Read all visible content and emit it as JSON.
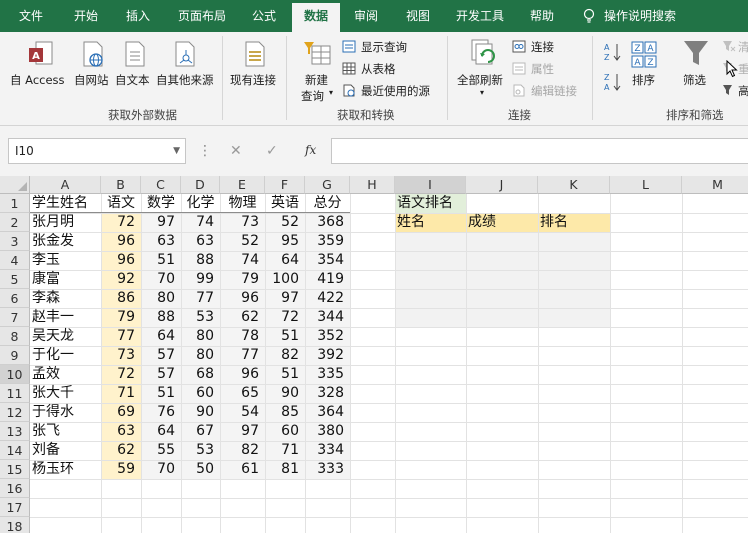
{
  "tabs": [
    "文件",
    "开始",
    "插入",
    "页面布局",
    "公式",
    "数据",
    "审阅",
    "视图",
    "开发工具",
    "帮助",
    "操作说明搜索"
  ],
  "active_tab": "数据",
  "ribbon": {
    "get_external": {
      "access": "自 Access",
      "web": "自网站",
      "text": "自文本",
      "other": "自其他来源",
      "existing": "现有连接",
      "label": "获取外部数据"
    },
    "get_transform": {
      "new_query_1": "新建",
      "new_query_2": "查询",
      "show_queries": "显示查询",
      "from_table": "从表格",
      "recent_sources": "最近使用的源",
      "label": "获取和转换"
    },
    "connections": {
      "refresh_all": "全部刷新",
      "connections": "连接",
      "properties": "属性",
      "edit_links": "编辑链接",
      "label": "连接"
    },
    "sort_filter": {
      "sort": "排序",
      "filter": "筛选",
      "clear": "清",
      "reapply": "重",
      "advanced": "高",
      "label": "排序和筛选"
    }
  },
  "formula_bar": {
    "name_box": "I10",
    "fx": "fx",
    "cancel": "✕",
    "enter": "✓",
    "value": ""
  },
  "columns": [
    "A",
    "B",
    "C",
    "D",
    "E",
    "F",
    "G",
    "H",
    "I",
    "J",
    "K",
    "L",
    "M"
  ],
  "rows": [
    "1",
    "2",
    "3",
    "4",
    "5",
    "6",
    "7",
    "8",
    "9",
    "10",
    "11",
    "12",
    "13",
    "14",
    "15",
    "16",
    "17",
    "18"
  ],
  "table": {
    "headers": [
      "学生姓名",
      "语文",
      "数学",
      "化学",
      "物理",
      "英语",
      "总分"
    ],
    "rows": [
      [
        "张月明",
        "72",
        "97",
        "74",
        "73",
        "52",
        "368"
      ],
      [
        "张金发",
        "96",
        "63",
        "63",
        "52",
        "95",
        "359"
      ],
      [
        "李玉",
        "96",
        "51",
        "88",
        "74",
        "64",
        "354"
      ],
      [
        "康富",
        "92",
        "70",
        "99",
        "79",
        "100",
        "419"
      ],
      [
        "李森",
        "86",
        "80",
        "77",
        "96",
        "97",
        "422"
      ],
      [
        "赵丰一",
        "79",
        "88",
        "53",
        "62",
        "72",
        "344"
      ],
      [
        "吴天龙",
        "77",
        "64",
        "80",
        "78",
        "51",
        "352"
      ],
      [
        "于化一",
        "73",
        "57",
        "80",
        "77",
        "82",
        "392"
      ],
      [
        "孟效",
        "72",
        "57",
        "68",
        "96",
        "51",
        "335"
      ],
      [
        "张大千",
        "71",
        "51",
        "60",
        "65",
        "90",
        "328"
      ],
      [
        "于得水",
        "69",
        "76",
        "90",
        "54",
        "85",
        "364"
      ],
      [
        "张飞",
        "63",
        "64",
        "67",
        "97",
        "60",
        "380"
      ],
      [
        "刘备",
        "62",
        "55",
        "53",
        "82",
        "71",
        "334"
      ],
      [
        "杨玉环",
        "59",
        "70",
        "50",
        "61",
        "81",
        "333"
      ]
    ]
  },
  "rank_table": {
    "title": "语文排名",
    "headers": [
      "姓名",
      "成绩",
      "排名"
    ]
  },
  "colors": {
    "excel_green": "#217346",
    "highlight_green": "#e2efda",
    "highlight_yellow": "#fde9a9",
    "highlight_cream": "#fff2cc"
  }
}
